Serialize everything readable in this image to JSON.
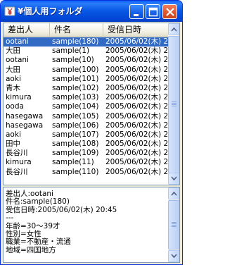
{
  "window": {
    "title": "¥個人用フォルダ"
  },
  "list": {
    "columns": [
      "差出人",
      "件名",
      "受信日時"
    ],
    "rows": [
      {
        "sender": "ootani",
        "subject": "sample(180)",
        "date": "2005/06/02(木) 2",
        "selected": true
      },
      {
        "sender": "大田",
        "subject": "sample(1)",
        "date": "2005/06/02(木) 2"
      },
      {
        "sender": "ootani",
        "subject": "sample(10)",
        "date": "2005/06/02(木) 2"
      },
      {
        "sender": "大田",
        "subject": "sample(100)",
        "date": "2005/06/02(木) 2"
      },
      {
        "sender": "aoki",
        "subject": "sample(101)",
        "date": "2005/06/02(木) 2"
      },
      {
        "sender": "青木",
        "subject": "sample(102)",
        "date": "2005/06/02(木) 2"
      },
      {
        "sender": "kimura",
        "subject": "sample(103)",
        "date": "2005/06/02(木) 2"
      },
      {
        "sender": "ooda",
        "subject": "sample(104)",
        "date": "2005/06/02(木) 2"
      },
      {
        "sender": "hasegawa",
        "subject": "sample(105)",
        "date": "2005/06/02(木) 2"
      },
      {
        "sender": "hasegawa",
        "subject": "sample(106)",
        "date": "2005/06/02(木) 2"
      },
      {
        "sender": "aoki",
        "subject": "sample(107)",
        "date": "2005/06/02(木) 2"
      },
      {
        "sender": "田中",
        "subject": "sample(108)",
        "date": "2005/06/02(木) 2"
      },
      {
        "sender": "長谷川",
        "subject": "sample(109)",
        "date": "2005/06/02(木) 2"
      },
      {
        "sender": "kimura",
        "subject": "sample(11)",
        "date": "2005/06/02(木) 2"
      },
      {
        "sender": "長谷川",
        "subject": "sample(110)",
        "date": "2005/06/02(木) 2"
      }
    ]
  },
  "preview": {
    "lines": [
      "差出人:ootani",
      "件名:sample(180)",
      "受信日時:2005/06/02(木) 20:45",
      "---",
      "年齢=30〜39才",
      "性別=女性",
      "職業=不動産・流通",
      "地域=四国地方"
    ]
  },
  "colors": {
    "selection": "#316ac5",
    "titlebar": "#0a5ae6",
    "close_button": "#e05a30"
  },
  "icons": {
    "app": "yen-folder-icon",
    "minimize": "minimize-icon",
    "maximize": "maximize-icon",
    "close": "close-icon"
  }
}
